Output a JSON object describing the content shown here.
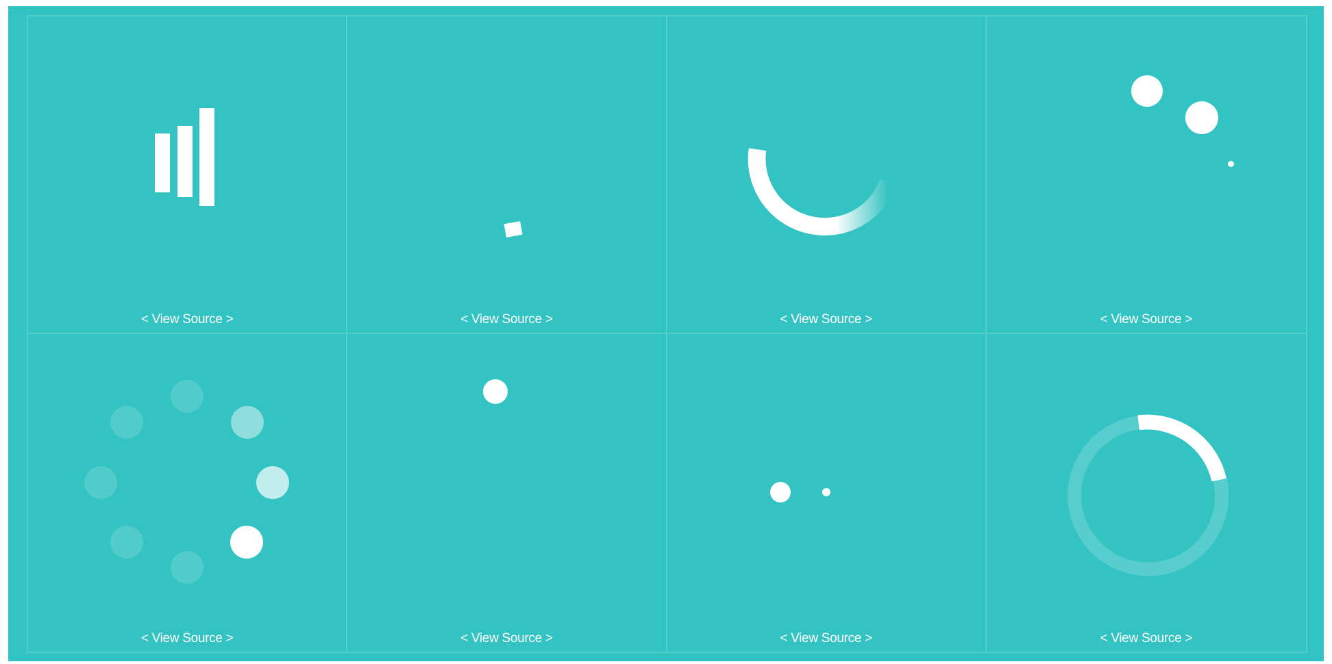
{
  "loaders": [
    {
      "id": "bars-loader",
      "link": "< View Source >"
    },
    {
      "id": "rotating-square-loader",
      "link": "< View Source >"
    },
    {
      "id": "arc-spinner-loader",
      "link": "< View Source >"
    },
    {
      "id": "orbit-dots-loader",
      "link": "< View Source >"
    },
    {
      "id": "circle-dots-loader",
      "link": "< View Source >"
    },
    {
      "id": "bouncing-dot-loader",
      "link": "< View Source >"
    },
    {
      "id": "pulse-dots-loader",
      "link": "< View Source >"
    },
    {
      "id": "ring-spinner-loader",
      "link": "< View Source >"
    }
  ],
  "colors": {
    "background": "#33c3c2",
    "grid_line": "#52cfcd",
    "foreground": "#ffffff"
  }
}
